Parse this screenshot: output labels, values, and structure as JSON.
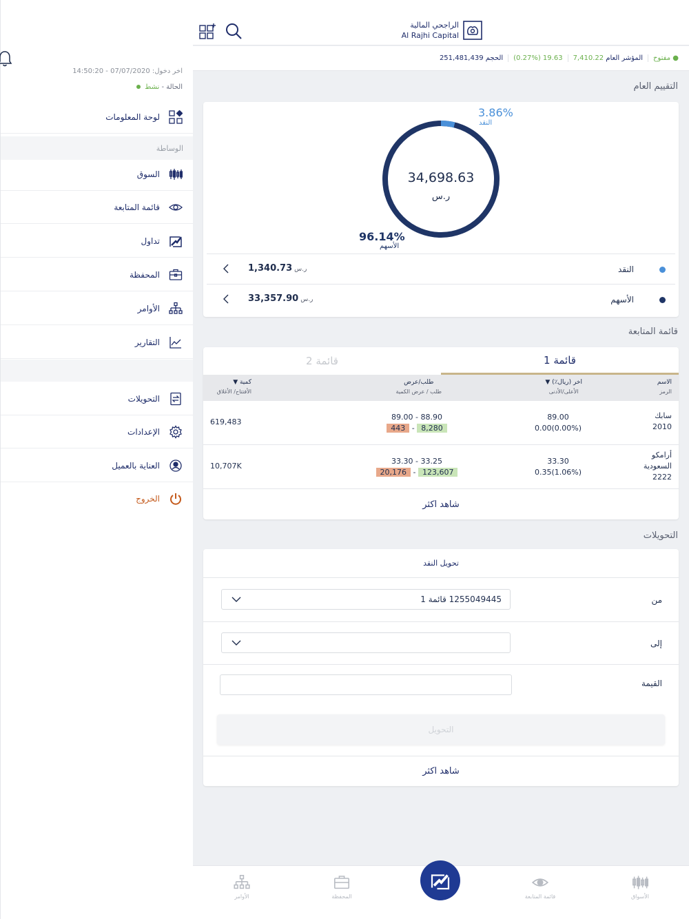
{
  "sidebar": {
    "last_login_label": "اخر دخول:",
    "last_login_value": "07/07/2020 - 14:50:20",
    "status_label": "الحالة -",
    "status_value": "نشط",
    "dashboard_label": "لوحة المعلومات",
    "section_brokerage": "الوساطة",
    "items": [
      {
        "label": "السوق",
        "icon": "candlestick-icon"
      },
      {
        "label": "قائمة المتابعة",
        "icon": "eye-icon"
      },
      {
        "label": "تداول",
        "icon": "trade-icon"
      },
      {
        "label": "المحفظة",
        "icon": "briefcase-icon"
      },
      {
        "label": "الأوامر",
        "icon": "hierarchy-icon"
      },
      {
        "label": "التقارير",
        "icon": "chart-icon"
      }
    ],
    "items2": [
      {
        "label": "التحويلات",
        "icon": "transfer-icon"
      },
      {
        "label": "الإعدادات",
        "icon": "gear-icon"
      },
      {
        "label": "العناية بالعميل",
        "icon": "support-icon"
      }
    ],
    "logout_label": "الخروج"
  },
  "brand": {
    "arabic_name": "الراجحي المالية",
    "english_name": "Al Rajhi Capital"
  },
  "ticker": {
    "status": "مفتوح",
    "index_label": "المؤشر العام",
    "index_value": "7,410.22",
    "change": "19.63 (0.27%)",
    "volume_label": "الحجم",
    "volume_value": "251,481,439"
  },
  "valuation": {
    "title": "التقييم العام",
    "total": "34,698.63",
    "currency": "ر.س",
    "cash_pct": "3.86%",
    "cash_label": "النقد",
    "equity_pct": "96.14%",
    "equity_label": "الأسهم",
    "rows": [
      {
        "name": "النقد",
        "value": "1,340.73",
        "currency": "ر.س",
        "color": "#4a90d9"
      },
      {
        "name": "الأسهم",
        "value": "33,357.90",
        "currency": "ر.س",
        "color": "#1f3566"
      }
    ]
  },
  "watchlist": {
    "title": "قائمة المتابعة",
    "tabs": [
      "قائمة 1",
      "قائمة 2"
    ],
    "headers": {
      "name": "الاسم",
      "symbol": "الرمز",
      "last": "اخر (ريال٪) ▼",
      "high_low": "الأعلى/الأدنى",
      "bid_ask": "طلب/عرض",
      "bid_ask_qty": "طلب / عرض الكمية",
      "qty": "كمية ▼",
      "open_close": "الأفتتاح/ الأغلاق"
    },
    "rows": [
      {
        "name": "سابك",
        "symbol": "2010",
        "last": "89.00",
        "change": "0.00(0.00%)",
        "bid_ask": "89.00 - 88.90",
        "ask_qty": "443",
        "bid_qty": "8,280",
        "qty": "619,483"
      },
      {
        "name": "أرامكو السعودية",
        "symbol": "2222",
        "last": "33.30",
        "change": "0.35(1.06%)",
        "bid_ask": "33.30 - 33.25",
        "ask_qty": "20,176",
        "bid_qty": "123,607",
        "qty": "10,707K"
      }
    ],
    "see_more": "شاهد اكثر"
  },
  "transfers": {
    "title": "التحويلات",
    "subtitle": "تحويل النقد",
    "from_label": "من",
    "from_value": "1255049445 قائمة 1",
    "to_label": "إلى",
    "to_value": "",
    "amount_label": "القيمة",
    "amount_value": "",
    "button_label": "التحويل",
    "see_more": "شاهد اكثر"
  },
  "bottom_nav": [
    {
      "label": "الأوامر",
      "icon": "hierarchy-icon"
    },
    {
      "label": "المحفظة",
      "icon": "briefcase-icon"
    },
    {
      "label": "قائمة المتابعة",
      "icon": "eye-icon"
    },
    {
      "label": "الأسواق",
      "icon": "candlestick-icon"
    }
  ],
  "colors": {
    "navy": "#1f3566",
    "accent": "#4a90d9",
    "active_green": "#6ab04c",
    "logout": "#c45a1c"
  }
}
